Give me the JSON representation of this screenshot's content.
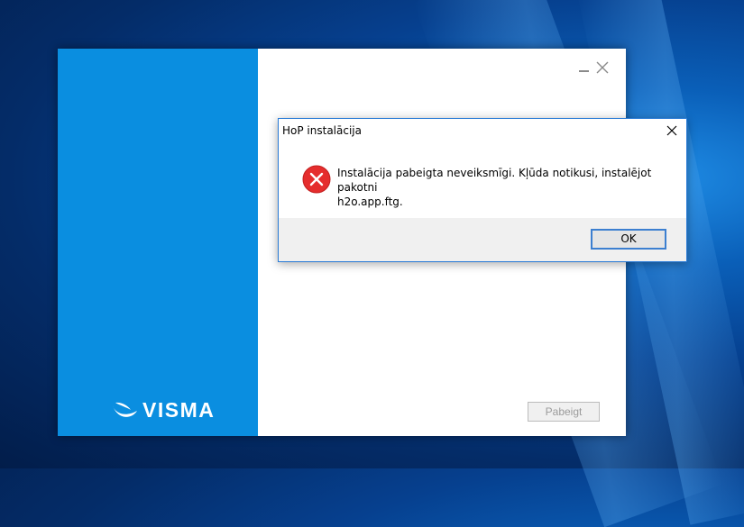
{
  "installer": {
    "brand_text": "VISMA",
    "finish_label": "Pabeigt"
  },
  "dialog": {
    "title": "HoP instalācija",
    "message_line1": "Instalācija pabeigta neveiksmīgi. Kļūda notikusi, instalējot pakotni",
    "message_line2": "h2o.app.ftg.",
    "ok_label": "OK"
  },
  "colors": {
    "installer_panel": "#0a8ee0",
    "error_red": "#e52d2d",
    "focus_border": "#3c7fd0"
  },
  "icons": {
    "minimize": "minimize-icon",
    "close": "close-icon",
    "error": "error-icon",
    "logo": "visma-logo-icon"
  }
}
